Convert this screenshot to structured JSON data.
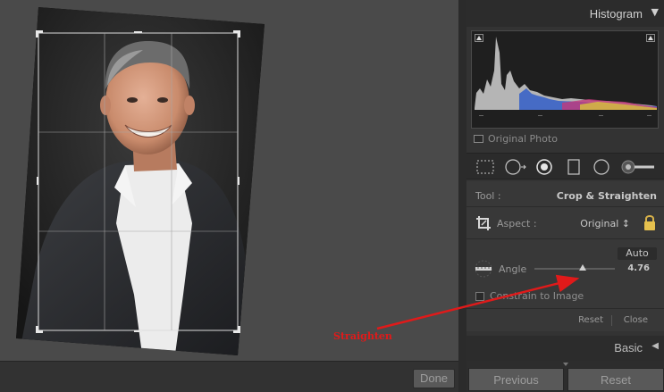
{
  "histogram": {
    "title": "Histogram",
    "toggle_icon": "triangle-down-icon",
    "original_photo_label": "Original Photo"
  },
  "tool_strip": {
    "tools": [
      "crop-overlay-icon",
      "spot-removal-icon",
      "red-eye-icon",
      "graduated-filter-icon",
      "radial-filter-icon",
      "adjustment-brush-icon"
    ]
  },
  "crop": {
    "tool_label": "Tool :",
    "tool_value": "Crop & Straighten",
    "aspect_label": "Aspect :",
    "aspect_value": "Original ↕",
    "auto_label": "Auto",
    "angle_label": "Angle",
    "angle_value": "4.76",
    "angle_slider_fraction": 0.6,
    "constrain_label": "Constrain to Image",
    "reset_label": "Reset",
    "close_label": "Close"
  },
  "basic": {
    "title": "Basic",
    "toggle_icon": "triangle-left-icon"
  },
  "buttons": {
    "done": "Done",
    "previous": "Previous",
    "reset": "Reset"
  },
  "annotation": {
    "text": "Straighten",
    "color": "#e01a1a"
  },
  "colors": {
    "panel_bg": "#333333",
    "workspace_bg": "#4a4a4a",
    "annotation_red": "#e01a1a"
  }
}
